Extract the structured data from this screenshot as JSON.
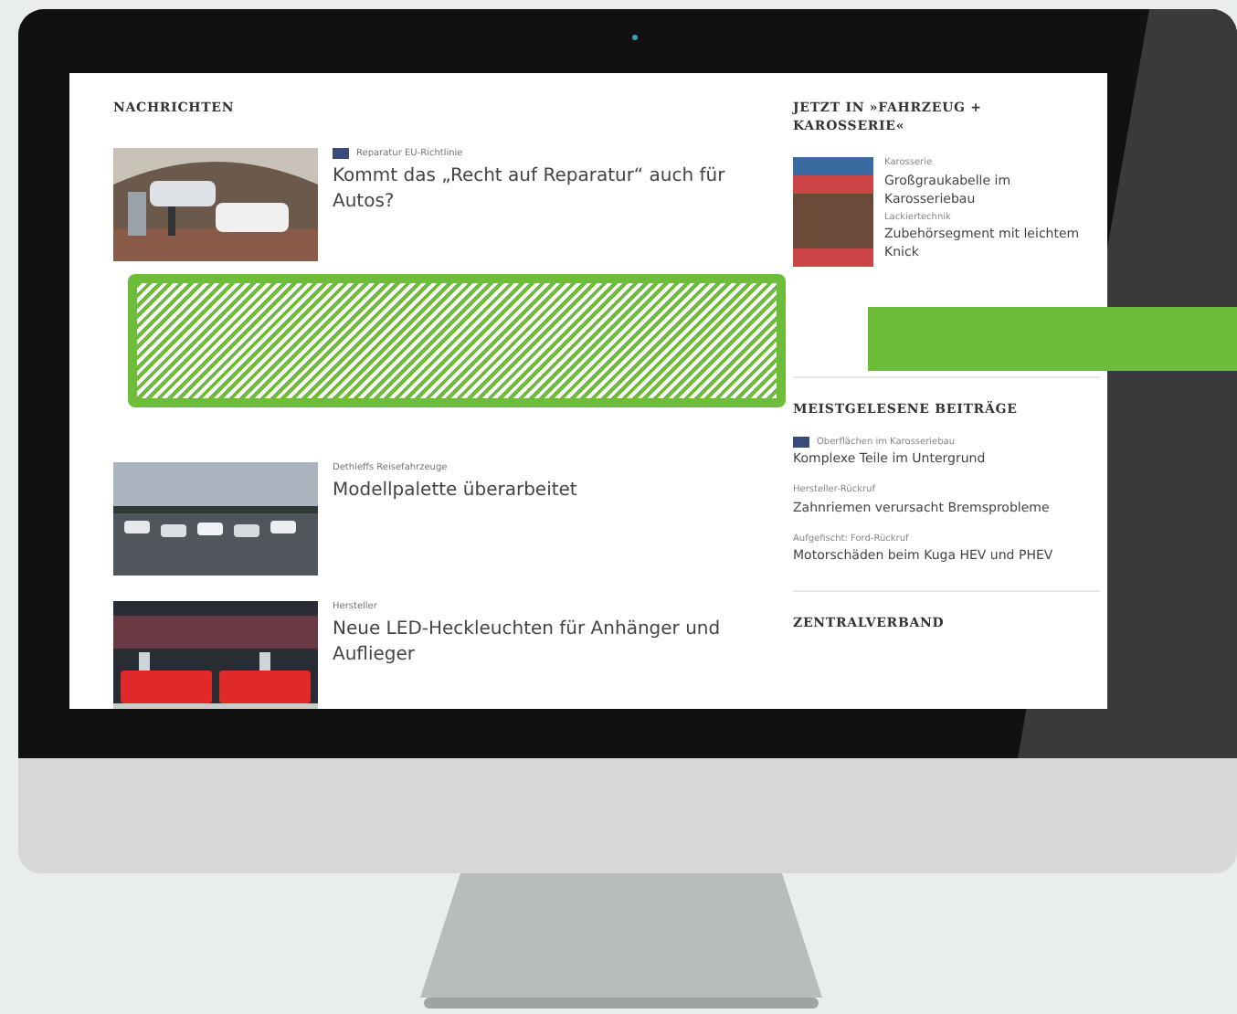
{
  "left_column": {
    "heading": "NACHRICHTEN",
    "articles": [
      {
        "kicker": "Reparatur EU-Richtlinie",
        "has_tag": true,
        "title": "Kommt das „Recht auf Reparatur“ auch für Autos?",
        "kind": "garage"
      },
      {
        "kicker": "Dethleffs Reisefahrzeuge",
        "has_tag": false,
        "title": "Modellpalette überarbeitet",
        "kind": "parking"
      },
      {
        "kicker": "Hersteller",
        "has_tag": false,
        "title": "Neue LED-Heckleuchten für Anhänger und Auflieger",
        "kind": "trailer"
      }
    ]
  },
  "sidebar": {
    "heading": "JETZT IN »FAHRZEUG + KAROSSERIE«",
    "issue_items": [
      {
        "kicker": "Karosserie",
        "title": "Großgraukabelle im Karosseriebau"
      },
      {
        "kicker": "Lackiertechnik",
        "title": "Zubehörsegment mit leichtem Knick"
      }
    ],
    "popular_heading": "MEISTGELESENE BEITRÄGE",
    "popular": [
      {
        "kicker": "Oberflächen im Karosseriebau",
        "has_tag": true,
        "title": "Komplexe Teile im Untergrund"
      },
      {
        "kicker": "Hersteller-Rückruf",
        "has_tag": false,
        "title": "Zahnriemen verursacht Bremsprobleme"
      },
      {
        "kicker": "Aufgefischt: Ford-Rückruf",
        "has_tag": false,
        "title": "Motorschäden beim Kuga HEV und PHEV"
      }
    ],
    "bottom_heading": "ZENTRALVERBAND"
  }
}
